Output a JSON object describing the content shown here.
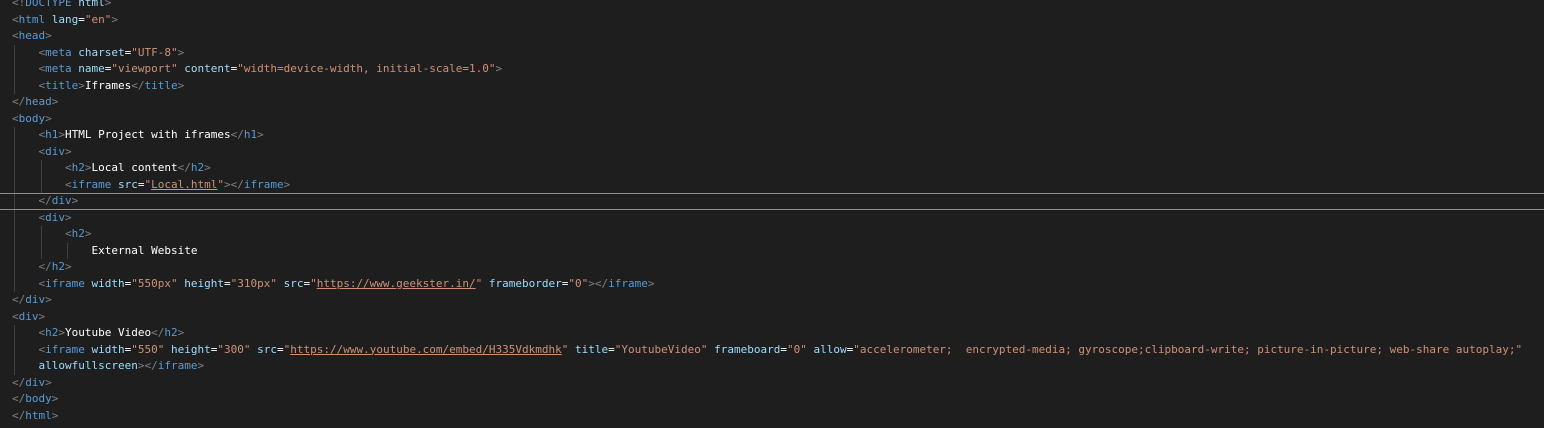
{
  "editor": {
    "lines": [
      {
        "indent": 0,
        "segments": [
          {
            "t": "<!",
            "c": "punct"
          },
          {
            "t": "DOCTYPE",
            "c": "tag"
          },
          {
            "t": " html",
            "c": "attr"
          },
          {
            "t": ">",
            "c": "punct"
          }
        ]
      },
      {
        "indent": 0,
        "segments": [
          {
            "t": "<",
            "c": "punct"
          },
          {
            "t": "html",
            "c": "tag"
          },
          {
            "t": " lang",
            "c": "attr"
          },
          {
            "t": "=",
            "c": "text"
          },
          {
            "t": "\"en\"",
            "c": "str"
          },
          {
            "t": ">",
            "c": "punct"
          }
        ]
      },
      {
        "indent": 0,
        "segments": [
          {
            "t": "<",
            "c": "punct"
          },
          {
            "t": "head",
            "c": "tag"
          },
          {
            "t": ">",
            "c": "punct"
          }
        ]
      },
      {
        "indent": 1,
        "segments": [
          {
            "t": "<",
            "c": "punct"
          },
          {
            "t": "meta",
            "c": "tag"
          },
          {
            "t": " charset",
            "c": "attr"
          },
          {
            "t": "=",
            "c": "text"
          },
          {
            "t": "\"UTF-8\"",
            "c": "str"
          },
          {
            "t": ">",
            "c": "punct"
          }
        ]
      },
      {
        "indent": 1,
        "segments": [
          {
            "t": "<",
            "c": "punct"
          },
          {
            "t": "meta",
            "c": "tag"
          },
          {
            "t": " name",
            "c": "attr"
          },
          {
            "t": "=",
            "c": "text"
          },
          {
            "t": "\"viewport\"",
            "c": "str"
          },
          {
            "t": " content",
            "c": "attr"
          },
          {
            "t": "=",
            "c": "text"
          },
          {
            "t": "\"width=device-width, initial-scale=1.0\"",
            "c": "str"
          },
          {
            "t": ">",
            "c": "punct"
          }
        ]
      },
      {
        "indent": 1,
        "segments": [
          {
            "t": "<",
            "c": "punct"
          },
          {
            "t": "title",
            "c": "tag"
          },
          {
            "t": ">",
            "c": "punct"
          },
          {
            "t": "Iframes",
            "c": "text"
          },
          {
            "t": "</",
            "c": "punct"
          },
          {
            "t": "title",
            "c": "tag"
          },
          {
            "t": ">",
            "c": "punct"
          }
        ]
      },
      {
        "indent": 0,
        "segments": [
          {
            "t": "</",
            "c": "punct"
          },
          {
            "t": "head",
            "c": "tag"
          },
          {
            "t": ">",
            "c": "punct"
          }
        ]
      },
      {
        "indent": 0,
        "segments": [
          {
            "t": "<",
            "c": "punct"
          },
          {
            "t": "body",
            "c": "tag"
          },
          {
            "t": ">",
            "c": "punct"
          }
        ]
      },
      {
        "indent": 1,
        "segments": [
          {
            "t": "<",
            "c": "punct"
          },
          {
            "t": "h1",
            "c": "tag"
          },
          {
            "t": ">",
            "c": "punct"
          },
          {
            "t": "HTML Project with iframes",
            "c": "text"
          },
          {
            "t": "</",
            "c": "punct"
          },
          {
            "t": "h1",
            "c": "tag"
          },
          {
            "t": ">",
            "c": "punct"
          }
        ]
      },
      {
        "indent": 1,
        "segments": [
          {
            "t": "<",
            "c": "punct"
          },
          {
            "t": "div",
            "c": "tag"
          },
          {
            "t": ">",
            "c": "punct"
          }
        ]
      },
      {
        "indent": 2,
        "segments": [
          {
            "t": "<",
            "c": "punct"
          },
          {
            "t": "h2",
            "c": "tag"
          },
          {
            "t": ">",
            "c": "punct"
          },
          {
            "t": "Local content",
            "c": "text"
          },
          {
            "t": "</",
            "c": "punct"
          },
          {
            "t": "h2",
            "c": "tag"
          },
          {
            "t": ">",
            "c": "punct"
          }
        ]
      },
      {
        "indent": 2,
        "segments": [
          {
            "t": "<",
            "c": "punct"
          },
          {
            "t": "iframe",
            "c": "tag"
          },
          {
            "t": " src",
            "c": "attr"
          },
          {
            "t": "=",
            "c": "text"
          },
          {
            "t": "\"",
            "c": "str"
          },
          {
            "t": "Local.html",
            "c": "str link"
          },
          {
            "t": "\"",
            "c": "str"
          },
          {
            "t": "></",
            "c": "punct"
          },
          {
            "t": "iframe",
            "c": "tag"
          },
          {
            "t": ">",
            "c": "punct"
          }
        ]
      },
      {
        "indent": 1,
        "current": true,
        "segments": [
          {
            "t": "</",
            "c": "punct"
          },
          {
            "t": "div",
            "c": "tag"
          },
          {
            "t": ">",
            "c": "punct"
          }
        ]
      },
      {
        "indent": 1,
        "segments": [
          {
            "t": "<",
            "c": "punct"
          },
          {
            "t": "div",
            "c": "tag"
          },
          {
            "t": ">",
            "c": "punct"
          }
        ]
      },
      {
        "indent": 2,
        "segments": [
          {
            "t": "<",
            "c": "punct"
          },
          {
            "t": "h2",
            "c": "tag"
          },
          {
            "t": ">",
            "c": "punct"
          }
        ]
      },
      {
        "indent": 3,
        "segments": [
          {
            "t": "External Website",
            "c": "text"
          }
        ]
      },
      {
        "indent": 1,
        "segments": [
          {
            "t": "</",
            "c": "punct"
          },
          {
            "t": "h2",
            "c": "tag"
          },
          {
            "t": ">",
            "c": "punct"
          }
        ]
      },
      {
        "indent": 1,
        "segments": [
          {
            "t": "<",
            "c": "punct"
          },
          {
            "t": "iframe",
            "c": "tag"
          },
          {
            "t": " width",
            "c": "attr"
          },
          {
            "t": "=",
            "c": "text"
          },
          {
            "t": "\"550px\"",
            "c": "str"
          },
          {
            "t": " height",
            "c": "attr"
          },
          {
            "t": "=",
            "c": "text"
          },
          {
            "t": "\"310px\"",
            "c": "str"
          },
          {
            "t": " src",
            "c": "attr"
          },
          {
            "t": "=",
            "c": "text"
          },
          {
            "t": "\"",
            "c": "str"
          },
          {
            "t": "https://www.geekster.in/",
            "c": "str link"
          },
          {
            "t": "\"",
            "c": "str"
          },
          {
            "t": " frameborder",
            "c": "attr"
          },
          {
            "t": "=",
            "c": "text"
          },
          {
            "t": "\"0\"",
            "c": "str"
          },
          {
            "t": "></",
            "c": "punct"
          },
          {
            "t": "iframe",
            "c": "tag"
          },
          {
            "t": ">",
            "c": "punct"
          }
        ]
      },
      {
        "indent": 0,
        "segments": [
          {
            "t": "</",
            "c": "punct"
          },
          {
            "t": "div",
            "c": "tag"
          },
          {
            "t": ">",
            "c": "punct"
          }
        ]
      },
      {
        "indent": 0,
        "segments": [
          {
            "t": "<",
            "c": "punct"
          },
          {
            "t": "div",
            "c": "tag"
          },
          {
            "t": ">",
            "c": "punct"
          }
        ]
      },
      {
        "indent": 1,
        "segments": [
          {
            "t": "<",
            "c": "punct"
          },
          {
            "t": "h2",
            "c": "tag"
          },
          {
            "t": ">",
            "c": "punct"
          },
          {
            "t": "Youtube Video",
            "c": "text"
          },
          {
            "t": "</",
            "c": "punct"
          },
          {
            "t": "h2",
            "c": "tag"
          },
          {
            "t": ">",
            "c": "punct"
          }
        ]
      },
      {
        "indent": 1,
        "segments": [
          {
            "t": "<",
            "c": "punct"
          },
          {
            "t": "iframe",
            "c": "tag"
          },
          {
            "t": " width",
            "c": "attr"
          },
          {
            "t": "=",
            "c": "text"
          },
          {
            "t": "\"550\"",
            "c": "str"
          },
          {
            "t": " height",
            "c": "attr"
          },
          {
            "t": "=",
            "c": "text"
          },
          {
            "t": "\"300\"",
            "c": "str"
          },
          {
            "t": " src",
            "c": "attr"
          },
          {
            "t": "=",
            "c": "text"
          },
          {
            "t": "\"",
            "c": "str"
          },
          {
            "t": "https://www.youtube.com/embed/H335Vdkmdhk",
            "c": "str link"
          },
          {
            "t": "\"",
            "c": "str"
          },
          {
            "t": " title",
            "c": "attr"
          },
          {
            "t": "=",
            "c": "text"
          },
          {
            "t": "\"YoutubeVideo\"",
            "c": "str"
          },
          {
            "t": " frameboard",
            "c": "attr"
          },
          {
            "t": "=",
            "c": "text"
          },
          {
            "t": "\"0\"",
            "c": "str"
          },
          {
            "t": " allow",
            "c": "attr"
          },
          {
            "t": "=",
            "c": "text"
          },
          {
            "t": "\"accelerometer;  encrypted-media; gyroscope;clipboard-write; picture-in-picture; web-share autoplay;\"",
            "c": "str"
          }
        ]
      },
      {
        "indent": 1,
        "segments": [
          {
            "t": "allowfullscreen",
            "c": "attr"
          },
          {
            "t": "></",
            "c": "punct"
          },
          {
            "t": "iframe",
            "c": "tag"
          },
          {
            "t": ">",
            "c": "punct"
          }
        ]
      },
      {
        "indent": 0,
        "segments": [
          {
            "t": "</",
            "c": "punct"
          },
          {
            "t": "div",
            "c": "tag"
          },
          {
            "t": ">",
            "c": "punct"
          }
        ]
      },
      {
        "indent": 0,
        "segments": [
          {
            "t": "</",
            "c": "punct"
          },
          {
            "t": "body",
            "c": "tag"
          },
          {
            "t": ">",
            "c": "punct"
          }
        ]
      },
      {
        "indent": 0,
        "segments": [
          {
            "t": "</",
            "c": "punct"
          },
          {
            "t": "html",
            "c": "tag"
          },
          {
            "t": ">",
            "c": "punct"
          }
        ]
      }
    ]
  }
}
